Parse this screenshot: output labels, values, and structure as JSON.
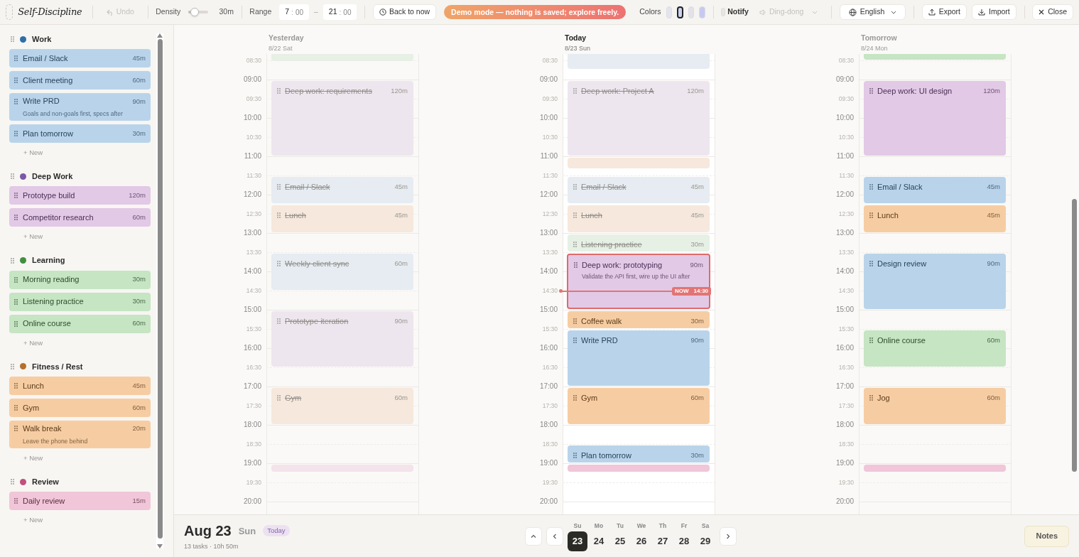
{
  "toolbar": {
    "app_title": "Self-Discipline",
    "undo": {
      "label": "Undo",
      "disabled": true
    },
    "density": {
      "label": "Density",
      "level": 0.3,
      "reading": "30m"
    },
    "range": {
      "label": "Range",
      "start_hour": "7",
      "start_min": "00",
      "separator": ":",
      "dash": "–",
      "end_hour": "21",
      "end_min": "00"
    },
    "back_button": "Back to now",
    "demo_banner": "Demo mode — nothing is saved; explore freely.",
    "colors_label": "Colors",
    "swatches": [
      {
        "color": "#e4e4f0",
        "selected": false
      },
      {
        "color": "#c9d3ee",
        "selected": true
      },
      {
        "color": "#e3e1ea",
        "selected": false
      },
      {
        "color": "#c7c8f2",
        "selected": false
      }
    ],
    "notify": {
      "label": "Notify",
      "checked": false
    },
    "sound": {
      "value": "Ding-dong",
      "disabled": true
    },
    "language": "English",
    "export": "Export",
    "import": "Import",
    "close": "Close"
  },
  "categories": [
    {
      "name": "Work",
      "color": "#2f6ea7",
      "kind": "work",
      "tasks": [
        {
          "title": "Email / Slack",
          "duration": "45m"
        },
        {
          "title": "Client meeting",
          "duration": "60m"
        },
        {
          "title": "Write PRD",
          "duration": "90m",
          "note": "Goals and non-goals first, specs after"
        },
        {
          "title": "Plan tomorrow",
          "duration": "30m"
        }
      ],
      "new_label": "+ New"
    },
    {
      "name": "Deep Work",
      "color": "#7c58a8",
      "kind": "deep",
      "tasks": [
        {
          "title": "Prototype build",
          "duration": "120m"
        },
        {
          "title": "Competitor research",
          "duration": "60m"
        }
      ],
      "new_label": "+ New"
    },
    {
      "name": "Learning",
      "color": "#3f8f3f",
      "kind": "learning",
      "tasks": [
        {
          "title": "Morning reading",
          "duration": "30m"
        },
        {
          "title": "Listening practice",
          "duration": "30m"
        },
        {
          "title": "Online course",
          "duration": "60m"
        }
      ],
      "new_label": "+ New"
    },
    {
      "name": "Fitness / Rest",
      "color": "#b5702a",
      "kind": "fitness",
      "tasks": [
        {
          "title": "Lunch",
          "duration": "45m"
        },
        {
          "title": "Gym",
          "duration": "60m"
        },
        {
          "title": "Walk break",
          "duration": "20m",
          "note": "Leave the phone behind"
        }
      ],
      "new_label": "+ New"
    },
    {
      "name": "Review",
      "color": "#c0507e",
      "kind": "review",
      "tasks": [
        {
          "title": "Daily review",
          "duration": "15m"
        }
      ],
      "new_label": "+ New"
    }
  ],
  "days": [
    {
      "label": "Yesterday",
      "date": "8/22 Sat",
      "selected": false,
      "time_labels": [
        "08:30",
        "09:00",
        "09:30",
        "10:00",
        "10:30",
        "11:00",
        "11:30",
        "12:00",
        "12:30",
        "13:00",
        "13:30",
        "14:00",
        "14:30",
        "15:00",
        "15:30",
        "16:00",
        "16:30",
        "17:00",
        "17:30",
        "18:00",
        "18:30",
        "19:00",
        "19:30",
        "20:00"
      ],
      "events": [
        {
          "kind": "learning",
          "done": true
        },
        {
          "kind": "deep",
          "title": "Deep work: requirements",
          "duration": "120m",
          "done": true
        },
        {
          "kind": "work",
          "title": "Email / Slack",
          "duration": "45m",
          "done": true
        },
        {
          "kind": "fitness",
          "title": "Lunch",
          "duration": "45m",
          "done": true
        },
        {
          "kind": "work",
          "title": "Weekly client sync",
          "duration": "60m",
          "done": true
        },
        {
          "kind": "deep",
          "title": "Prototype iteration",
          "duration": "90m",
          "done": true
        },
        {
          "kind": "fitness",
          "title": "Gym",
          "duration": "60m",
          "done": true
        },
        {
          "kind": "review",
          "done": true
        }
      ]
    },
    {
      "label": "Today",
      "date": "8/23 Sun",
      "selected": true,
      "time_labels": [
        "08:30",
        "09:00",
        "09:30",
        "10:00",
        "10:30",
        "11:00",
        "11:30",
        "12:00",
        "12:30",
        "13:00",
        "13:30",
        "14:00",
        "14:30",
        "15:00",
        "15:30",
        "16:00",
        "16:30",
        "17:00",
        "17:30",
        "18:00",
        "18:30",
        "19:00",
        "19:30",
        "20:00"
      ],
      "now": {
        "badge": "NOW",
        "reading": "14:30"
      },
      "events": [
        {
          "kind": "work",
          "done": true
        },
        {
          "kind": "deep",
          "title": "Deep work: Project A",
          "duration": "120m",
          "done": true
        },
        {
          "kind": "fitness",
          "done": true
        },
        {
          "kind": "work",
          "title": "Email / Slack",
          "duration": "45m",
          "done": true
        },
        {
          "kind": "fitness",
          "title": "Lunch",
          "duration": "45m",
          "done": true
        },
        {
          "kind": "learning",
          "title": "Listening practice",
          "duration": "30m",
          "done": true
        },
        {
          "kind": "deep",
          "title": "Deep work: prototyping",
          "duration": "90m",
          "note": "Validate the API first, wire up the UI after",
          "done": false,
          "current": true
        },
        {
          "kind": "fitness",
          "title": "Coffee walk",
          "duration": "30m",
          "done": false
        },
        {
          "kind": "work",
          "title": "Write PRD",
          "duration": "90m",
          "done": false
        },
        {
          "kind": "fitness",
          "title": "Gym",
          "duration": "60m",
          "done": false
        },
        {
          "kind": "work",
          "title": "Plan tomorrow",
          "duration": "30m",
          "done": false
        },
        {
          "kind": "review",
          "done": false
        }
      ]
    },
    {
      "label": "Tomorrow",
      "date": "8/24 Mon",
      "selected": false,
      "time_labels": [
        "08:30",
        "09:00",
        "09:30",
        "10:00",
        "10:30",
        "11:00",
        "11:30",
        "12:00",
        "12:30",
        "13:00",
        "13:30",
        "14:00",
        "14:30",
        "15:00",
        "15:30",
        "16:00",
        "16:30",
        "17:00",
        "17:30",
        "18:00",
        "18:30",
        "19:00",
        "19:30",
        "20:00"
      ],
      "events": [
        {
          "kind": "learning",
          "done": false
        },
        {
          "kind": "deep",
          "title": "Deep work: UI design",
          "duration": "120m",
          "done": false
        },
        {
          "kind": "work",
          "title": "Email / Slack",
          "duration": "45m",
          "done": false
        },
        {
          "kind": "fitness",
          "title": "Lunch",
          "duration": "45m",
          "done": false
        },
        {
          "kind": "work",
          "title": "Design review",
          "duration": "90m",
          "done": false
        },
        {
          "kind": "learning",
          "title": "Online course",
          "duration": "60m",
          "done": false
        },
        {
          "kind": "fitness",
          "title": "Jog",
          "duration": "60m",
          "done": false
        },
        {
          "kind": "review",
          "done": false
        }
      ]
    }
  ],
  "footer": {
    "date": "Aug 23",
    "weekday": "Sun",
    "today_badge": "Today",
    "summary": "13 tasks · 10h 50m",
    "week": [
      {
        "weekday": "Su",
        "day": "23",
        "selected": true
      },
      {
        "weekday": "Mo",
        "day": "24",
        "selected": false
      },
      {
        "weekday": "Tu",
        "day": "25",
        "selected": false
      },
      {
        "weekday": "We",
        "day": "26",
        "selected": false
      },
      {
        "weekday": "Th",
        "day": "27",
        "selected": false
      },
      {
        "weekday": "Fr",
        "day": "28",
        "selected": false
      },
      {
        "weekday": "Sa",
        "day": "29",
        "selected": false
      }
    ],
    "notes_button": "Notes"
  }
}
